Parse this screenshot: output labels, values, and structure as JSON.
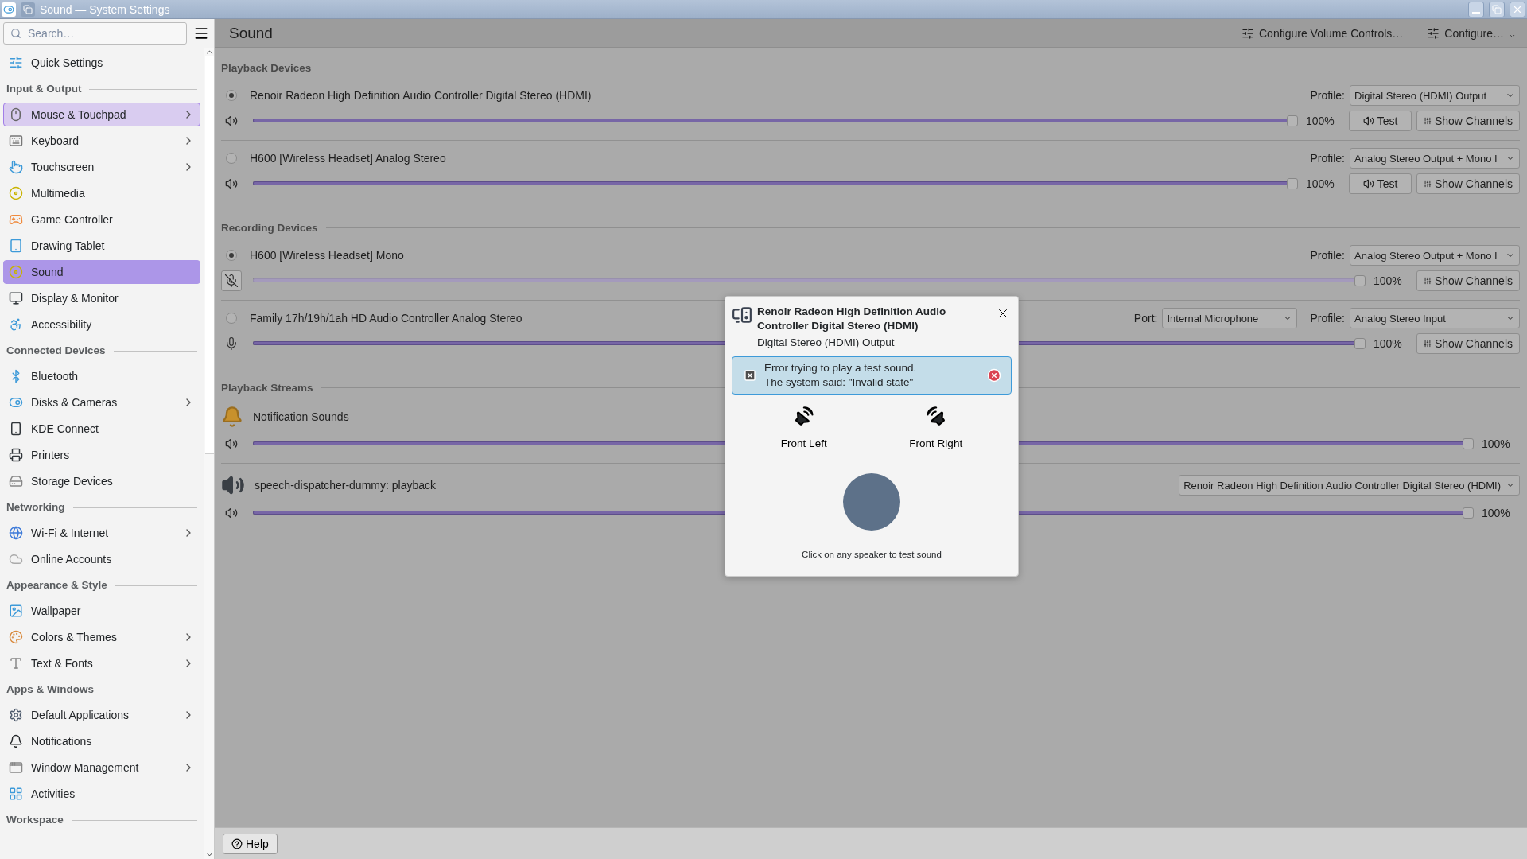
{
  "window": {
    "title": "Sound — System Settings"
  },
  "sidebar": {
    "search": {
      "placeholder": "Search…"
    },
    "groups": [
      {
        "items": [
          {
            "label": "Quick Settings",
            "selected": false,
            "hovered": false,
            "submenu": false
          }
        ]
      },
      {
        "heading": "Input & Output",
        "items": [
          {
            "label": "Mouse & Touchpad",
            "selected": false,
            "hovered": true,
            "submenu": true
          },
          {
            "label": "Keyboard",
            "selected": false,
            "hovered": false,
            "submenu": true
          },
          {
            "label": "Touchscreen",
            "selected": false,
            "hovered": false,
            "submenu": true
          },
          {
            "label": "Multimedia",
            "selected": false,
            "hovered": false,
            "submenu": false
          },
          {
            "label": "Game Controller",
            "selected": false,
            "hovered": false,
            "submenu": false
          },
          {
            "label": "Drawing Tablet",
            "selected": false,
            "hovered": false,
            "submenu": false
          },
          {
            "label": "Sound",
            "selected": true,
            "hovered": false,
            "submenu": false
          },
          {
            "label": "Display & Monitor",
            "selected": false,
            "hovered": false,
            "submenu": false
          },
          {
            "label": "Accessibility",
            "selected": false,
            "hovered": false,
            "submenu": false
          }
        ]
      },
      {
        "heading": "Connected Devices",
        "items": [
          {
            "label": "Bluetooth",
            "selected": false,
            "hovered": false,
            "submenu": false
          },
          {
            "label": "Disks & Cameras",
            "selected": false,
            "hovered": false,
            "submenu": true
          },
          {
            "label": "KDE Connect",
            "selected": false,
            "hovered": false,
            "submenu": false
          },
          {
            "label": "Printers",
            "selected": false,
            "hovered": false,
            "submenu": false
          },
          {
            "label": "Storage Devices",
            "selected": false,
            "hovered": false,
            "submenu": false
          }
        ]
      },
      {
        "heading": "Networking",
        "items": [
          {
            "label": "Wi-Fi & Internet",
            "selected": false,
            "hovered": false,
            "submenu": true
          },
          {
            "label": "Online Accounts",
            "selected": false,
            "hovered": false,
            "submenu": false
          }
        ]
      },
      {
        "heading": "Appearance & Style",
        "items": [
          {
            "label": "Wallpaper",
            "selected": false,
            "hovered": false,
            "submenu": false
          },
          {
            "label": "Colors & Themes",
            "selected": false,
            "hovered": false,
            "submenu": true
          },
          {
            "label": "Text & Fonts",
            "selected": false,
            "hovered": false,
            "submenu": true
          }
        ]
      },
      {
        "heading": "Apps & Windows",
        "items": [
          {
            "label": "Default Applications",
            "selected": false,
            "hovered": false,
            "submenu": true
          },
          {
            "label": "Notifications",
            "selected": false,
            "hovered": false,
            "submenu": false
          },
          {
            "label": "Window Management",
            "selected": false,
            "hovered": false,
            "submenu": true
          },
          {
            "label": "Activities",
            "selected": false,
            "hovered": false,
            "submenu": false
          }
        ]
      },
      {
        "heading": "Workspace"
      }
    ]
  },
  "header": {
    "title": "Sound",
    "actions": [
      {
        "label": "Configure Volume Controls…"
      },
      {
        "label": "Configure…"
      }
    ]
  },
  "sections": [
    {
      "title": "Playback Devices",
      "kind": "playback",
      "devices": [
        {
          "name": "Renoir Radeon High Definition Audio Controller Digital Stereo (HDMI)",
          "selected": true,
          "muted": false,
          "level": 1,
          "reading": "100%",
          "profile_label": "Profile:",
          "profile": "Digital Stereo (HDMI) Output",
          "buttons": [
            "Test",
            "Show Channels"
          ]
        },
        {
          "name": "H600 [Wireless Headset] Analog Stereo",
          "selected": false,
          "muted": false,
          "level": 1,
          "reading": "100%",
          "profile_label": "Profile:",
          "profile": "Analog Stereo Output + Mono I",
          "buttons": [
            "Test",
            "Show Channels"
          ]
        }
      ]
    },
    {
      "title": "Recording Devices",
      "kind": "recording",
      "devices": [
        {
          "name": "H600 [Wireless Headset] Mono",
          "selected": true,
          "muted": true,
          "level": 1,
          "reading": "100%",
          "profile_label": "Profile:",
          "profile": "Analog Stereo Output + Mono I",
          "buttons": [
            "Show Channels"
          ]
        },
        {
          "name": "Family 17h/19h/1ah HD Audio Controller Analog Stereo",
          "selected": false,
          "muted": false,
          "level": 1,
          "reading": "100%",
          "port_label": "Port:",
          "port": "Internal Microphone",
          "profile_label": "Profile:",
          "profile": "Analog Stereo Input",
          "buttons": [
            "Show Channels"
          ]
        }
      ]
    },
    {
      "title": "Playback Streams",
      "kind": "streams",
      "streams": [
        {
          "name": "Notification Sounds",
          "level": 1,
          "reading": "100%"
        },
        {
          "name": "speech-dispatcher-dummy: playback",
          "level": 1,
          "reading": "100%",
          "device": "Renoir Radeon High Definition Audio Controller Digital Stereo (HDMI)"
        }
      ]
    }
  ],
  "dialog": {
    "title": "Renoir Radeon High Definition Audio Controller Digital Stereo (HDMI)",
    "subtitle": "Digital Stereo (HDMI) Output",
    "error": "Error trying to play a test sound.\nThe system said: \"Invalid state\"",
    "speakers": [
      {
        "label": "Front Left"
      },
      {
        "label": "Front Right"
      }
    ],
    "hint": "Click on any speaker to test sound"
  },
  "footer": {
    "help": "Help"
  }
}
